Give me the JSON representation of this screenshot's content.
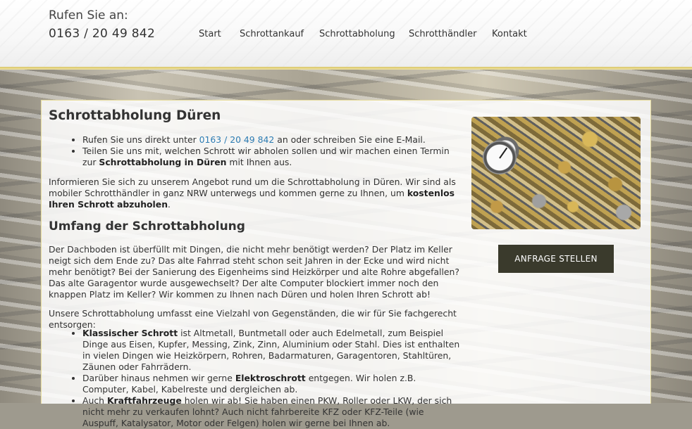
{
  "header": {
    "phone_label": "Rufen Sie an:",
    "phone_number": "0163 / 20 49 842",
    "nav": [
      "Start",
      "Schrottankauf",
      "Schrottabholung",
      "Schrotthändler",
      "Kontakt"
    ]
  },
  "main": {
    "title": "Schrottabholung Düren",
    "intro_list": {
      "item1_pre": "Rufen Sie uns direkt unter",
      "item1_link": "0163 / 20 49 842",
      "item1_post": "an oder schreiben Sie eine E-Mail.",
      "item2_pre": "Teilen Sie uns mit, welchen Schrott wir abholen sollen und wir machen einen Termin zur",
      "item2_bold": "Schrottabholung in Düren",
      "item2_post": "mit Ihnen aus."
    },
    "para1_pre": "Informieren Sie sich zu unserem Angebot rund um die Schrottabholung in Düren. Wir sind als mobiler Schrotthändler in ganz NRW unterwegs und kommen gerne zu Ihnen, um",
    "para1_bold": "kostenlos Ihren Schrott abzuholen",
    "para1_post": ".",
    "heading2": "Umfang der Schrottabholung",
    "para2": "Der Dachboden ist überfüllt mit Dingen, die nicht mehr benötigt werden? Der Platz im Keller neigt sich dem Ende zu? Das alte Fahrrad steht schon seit Jahren in der Ecke und wird nicht mehr benötigt? Bei der Sanierung des Eigenheims sind Heizkörper und alte Rohre abgefallen? Das alte Garagentor wurde ausgewechselt? Der alte Computer blockiert immer noch den knappen Platz im Keller? Wir kommen zu Ihnen nach Düren und holen Ihren Schrott ab!",
    "para3": "Unsere Schrottabholung umfasst eine Vielzahl von Gegenständen, die wir für Sie fachgerecht entsorgen:",
    "scope_list": {
      "item1_bold": "Klassischer Schrott",
      "item1_post": "ist Altmetall, Buntmetall oder auch Edelmetall, zum Beispiel Dinge aus Eisen, Kupfer, Messing, Zink, Zinn, Aluminium oder Stahl. Dies ist enthalten in vielen Dingen wie Heizkörpern, Rohren, Badarmaturen, Garagentoren, Stahltüren, Zäunen oder Fahrrädern.",
      "item2_pre": "Darüber hinaus nehmen wir gerne",
      "item2_bold": "Elektroschrott",
      "item2_post": "entgegen. Wir holen z.B. Computer, Kabel, Kabelreste und dergleichen ab.",
      "item3_pre": "Auch",
      "item3_bold": "Kraftfahrzeuge",
      "item3_post": "holen wir ab! Sie haben einen PKW, Roller oder LKW, der sich nicht mehr zu verkaufen lohnt? Auch nicht fahrbereite KFZ oder KFZ-Teile (wie Auspuff, Katalysator, Motor oder Felgen) holen wir gerne bei Ihnen ab."
    },
    "cta_label": "ANFRAGE STELLEN"
  }
}
